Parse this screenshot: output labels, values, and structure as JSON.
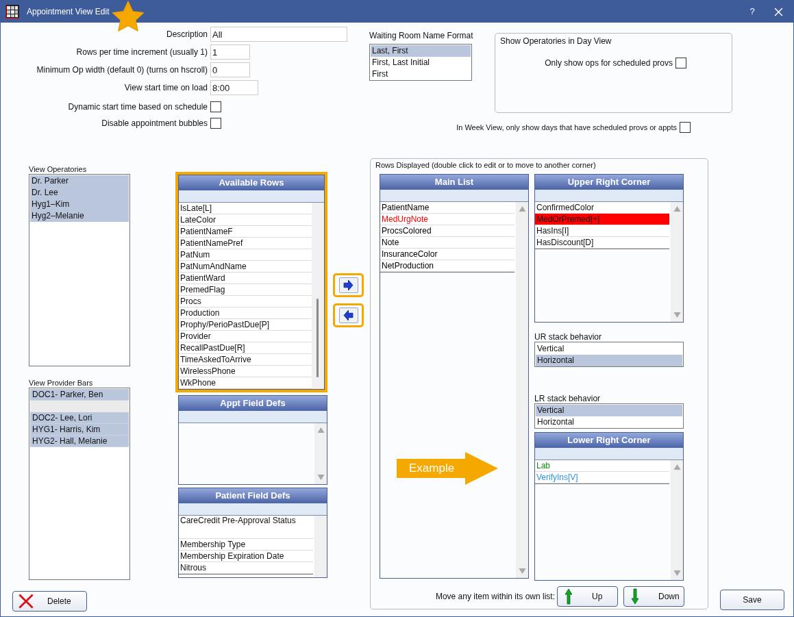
{
  "window": {
    "title": "Appointment View Edit",
    "help": "?"
  },
  "form": {
    "fields": [
      {
        "label": "Description",
        "value": "All",
        "kind": "wide"
      },
      {
        "label": "Rows per time increment (usually 1)",
        "value": "1",
        "kind": "short"
      },
      {
        "label": "Minimum Op width (default 0) (turns on hscroll)",
        "value": "0",
        "kind": "short"
      },
      {
        "label": "View start time on load",
        "value": "8:00",
        "kind": "medium"
      }
    ],
    "checkboxes": [
      {
        "label": "Dynamic start time based on schedule",
        "checked": false
      },
      {
        "label": "Disable appointment bubbles",
        "checked": false
      }
    ]
  },
  "waiting_room": {
    "label": "Waiting Room Name Format",
    "options": [
      {
        "text": "Last, First",
        "selected": true
      },
      {
        "text": "First, Last Initial",
        "selected": false
      },
      {
        "text": "First",
        "selected": false
      }
    ]
  },
  "show_operatories": {
    "title": "Show Operatories in Day View",
    "checkbox": {
      "label": "Only show ops for scheduled provs",
      "checked": false
    }
  },
  "week_view": {
    "label": "In Week View, only show days that have scheduled provs or appts",
    "checked": false
  },
  "view_operatories": {
    "label": "View Operatories",
    "items": [
      {
        "text": "Dr. Parker",
        "selected": true
      },
      {
        "text": "Dr. Lee",
        "selected": true
      },
      {
        "text": "Hyg1–Kim",
        "selected": true
      },
      {
        "text": "Hyg2–Melanie",
        "selected": true
      }
    ]
  },
  "view_provider_bars": {
    "label": "View Provider Bars",
    "items": [
      {
        "text": "DOC1- Parker, Ben",
        "selected": true
      },
      {
        "selected": false
      },
      {
        "text": "DOC2- Lee, Lori",
        "selected": true
      },
      {
        "text": "HYG1- Harris, Kim",
        "selected": true
      },
      {
        "text": "HYG2- Hall, Melanie",
        "selected": true
      }
    ]
  },
  "available_rows": {
    "title": "Available Rows",
    "highlighted": true,
    "items": [
      "IsLate[L]",
      "LateColor",
      "PatientNameF",
      "PatientNamePref",
      "PatNum",
      "PatNumAndName",
      "PatientWard",
      "PremedFlag",
      "Procs",
      "Production",
      "Prophy/PerioPastDue[P]",
      "Provider",
      "RecallPastDue[R]",
      "TimeAskedToArrive",
      "WirelessPhone",
      "WkPhone"
    ]
  },
  "transfer_buttons": [
    {
      "kind": "right",
      "highlighted": true
    },
    {
      "kind": "left",
      "highlighted": true
    }
  ],
  "appt_field_defs": {
    "title": "Appt Field Defs"
  },
  "patient_field_defs": {
    "title": "Patient Field Defs",
    "items": [
      {
        "text": "CareCredit Pre-Approval Status",
        "kind": "tall"
      },
      {
        "text": "Membership Type",
        "kind": "normal"
      },
      {
        "text": "Membership Expiration Date",
        "kind": "normal"
      },
      {
        "text": "Nitrous",
        "kind": "normal"
      }
    ]
  },
  "delete_button": "Delete",
  "rows_displayed": {
    "title": "Rows Displayed (double click to edit or to move to another corner)",
    "main_list": {
      "title": "Main List",
      "items": [
        {
          "text": "PatientName",
          "color": "#000000"
        },
        {
          "text": "MedUrgNote",
          "color": "#ff0000"
        },
        {
          "text": "ProcsColored",
          "color": "#000000"
        },
        {
          "text": "Note",
          "color": "#000000"
        },
        {
          "text": "InsuranceColor",
          "color": "#000000"
        },
        {
          "text": "NetProduction",
          "color": "#000000"
        }
      ]
    },
    "upper_right": {
      "title": "Upper Right Corner",
      "items": [
        {
          "text": "ConfirmedColor",
          "highlighted": false
        },
        {
          "text": "MedOrPremed[+]",
          "highlighted": true
        },
        {
          "text": "HasIns[I]",
          "highlighted": false
        },
        {
          "text": "HasDiscount[D]",
          "highlighted": false
        }
      ]
    },
    "ur_stack": {
      "label": "UR stack behavior",
      "options": [
        {
          "text": "Vertical",
          "selected": false
        },
        {
          "text": "Horizontal",
          "selected": true
        }
      ]
    },
    "lr_stack": {
      "label": "LR stack behavior",
      "options": [
        {
          "text": "Vertical",
          "selected": true
        },
        {
          "text": "Horizontal",
          "selected": false
        }
      ]
    },
    "lower_right": {
      "title": "Lower Right Corner",
      "items": [
        {
          "text": "Lab",
          "color": "#138a13"
        },
        {
          "text": "VerifyIns[V]",
          "color": "#2d93dc"
        }
      ]
    },
    "move_label": "Move any item within its own list:",
    "up_button": "Up",
    "down_button": "Down"
  },
  "callout": {
    "text": "Example"
  },
  "save_button": "Save"
}
